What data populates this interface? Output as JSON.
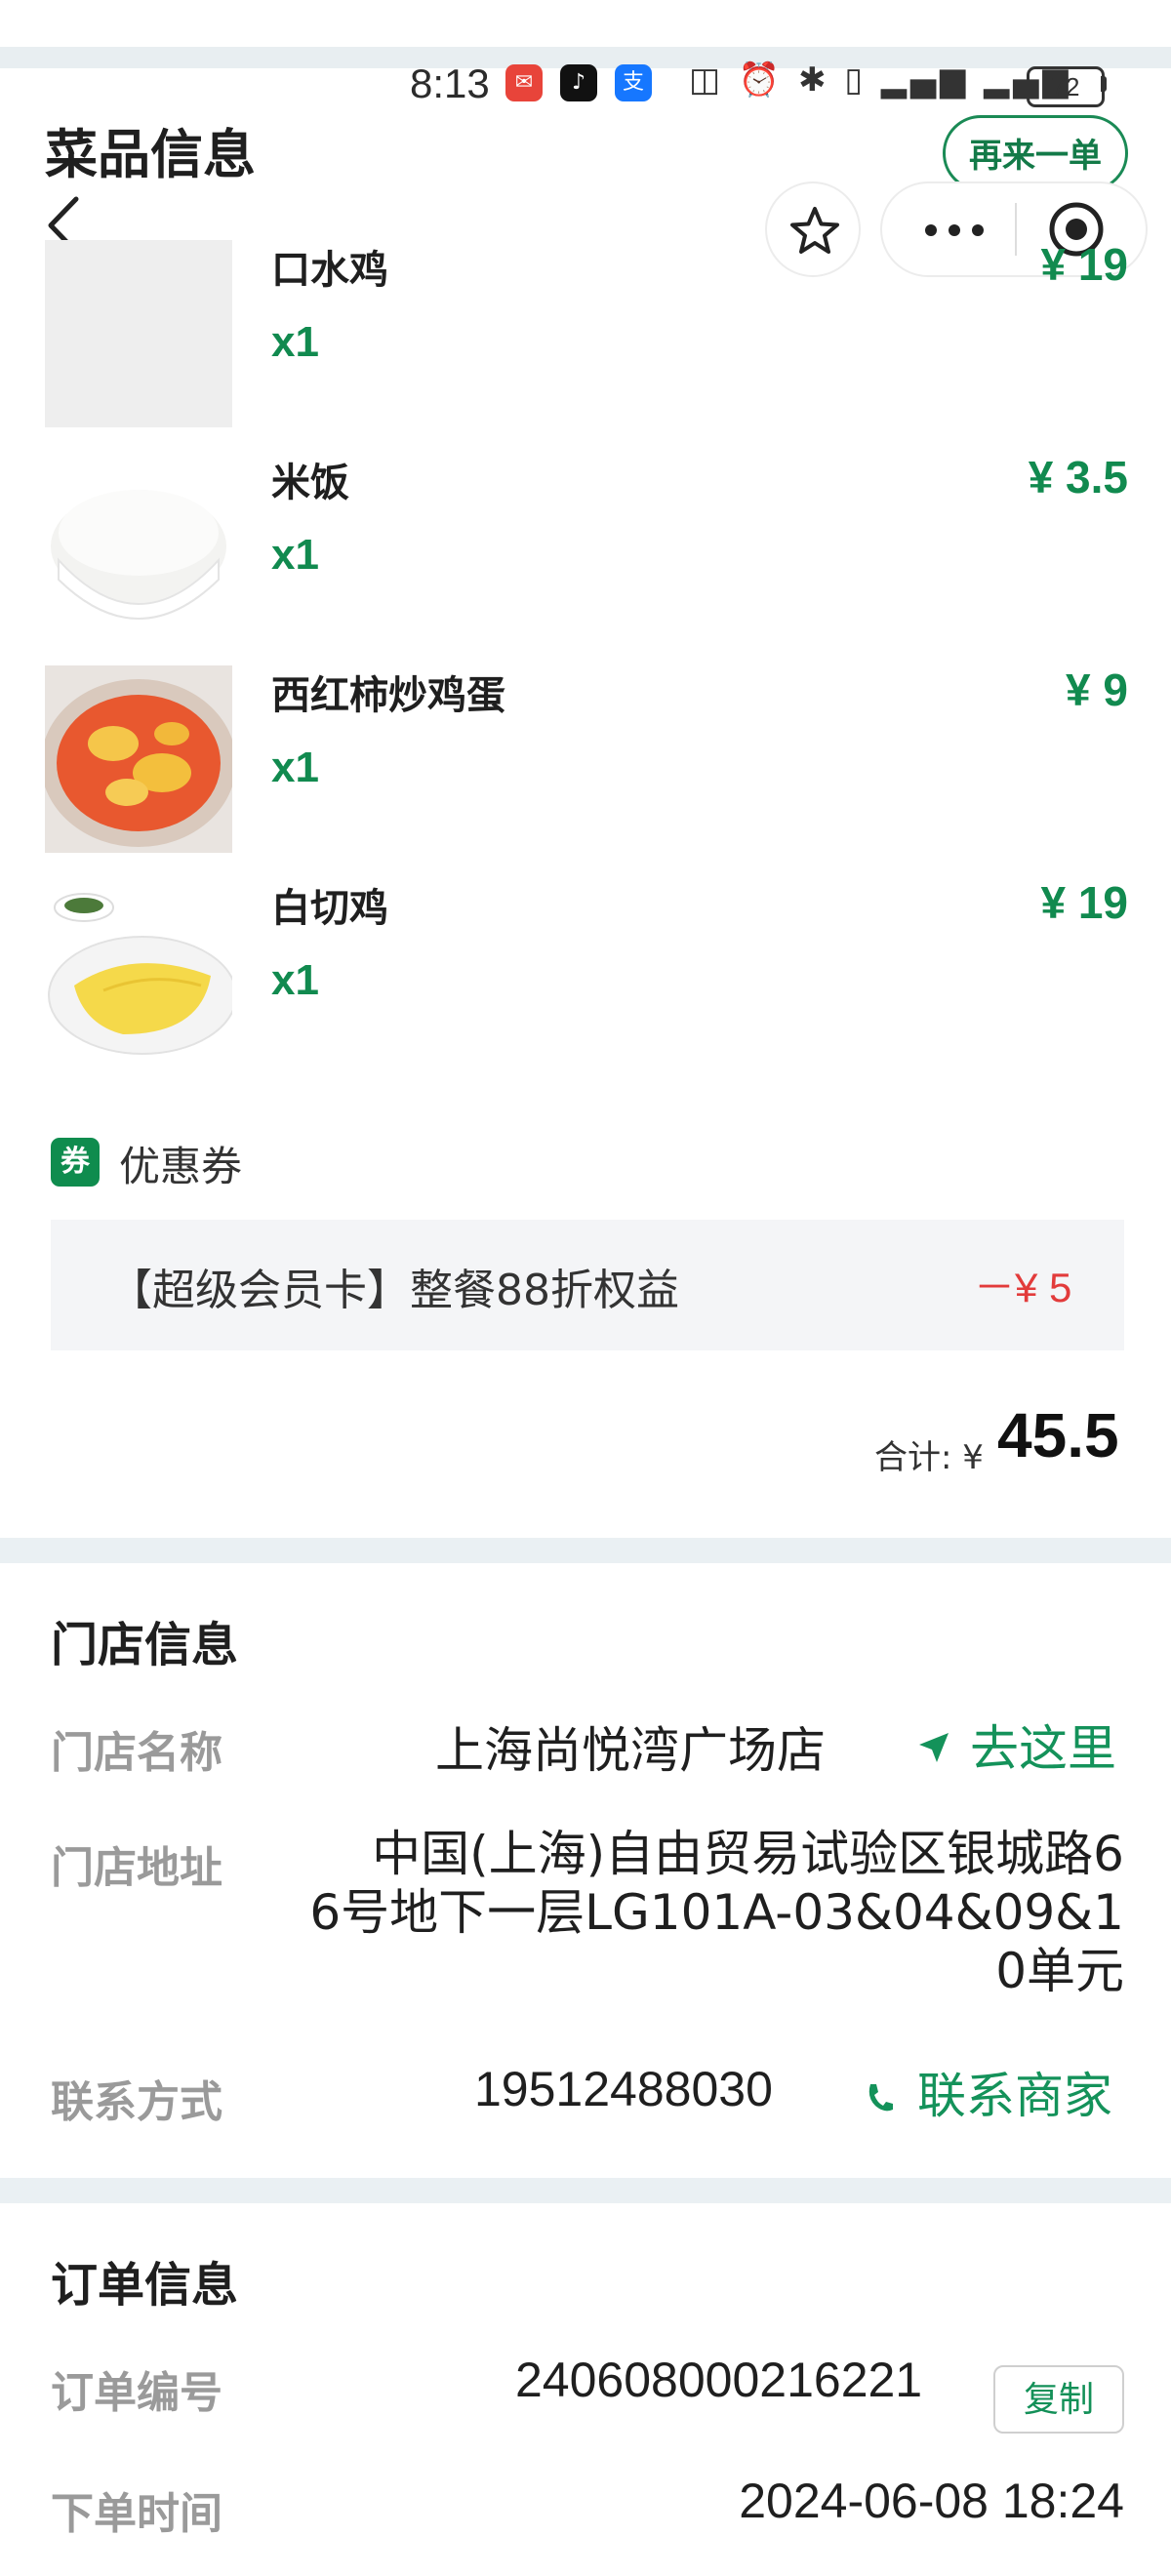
{
  "status_bar": {
    "time": "8:13",
    "battery": "72"
  },
  "header": {
    "title": "菜品信息",
    "reorder_label": "再来一单"
  },
  "dishes": [
    {
      "name": "口水鸡",
      "qty": "x1",
      "price": "¥ 19"
    },
    {
      "name": "米饭",
      "qty": "x1",
      "price": "¥ 3.5"
    },
    {
      "name": "西红柿炒鸡蛋",
      "qty": "x1",
      "price": "¥ 9"
    },
    {
      "name": "白切鸡",
      "qty": "x1",
      "price": "¥ 19"
    }
  ],
  "coupon": {
    "badge": "券",
    "label": "优惠券",
    "name": "【超级会员卡】整餐88折权益",
    "amount": "－¥ 5"
  },
  "total": {
    "label": "合计: ¥",
    "value": "45.5"
  },
  "store": {
    "title": "门店信息",
    "name_label": "门店名称",
    "name": "上海尚悦湾广场店",
    "navigate": "去这里",
    "address_label": "门店地址",
    "address_lines": [
      "中国(上海)自由贸易试验区银城路6",
      "6号地下一层LG101A-03&04&09&1",
      "0单元"
    ],
    "contact_label": "联系方式",
    "phone": "19512488030",
    "contact_action": "联系商家"
  },
  "order": {
    "title": "订单信息",
    "number_label": "订单编号",
    "number": "240608000216221",
    "copy_label": "复制",
    "time_label": "下单时间",
    "time": "2024-06-08 18:24"
  },
  "colors": {
    "accent": "#118a4f",
    "discount": "#e23b3b",
    "separator": "#eaf0f3"
  }
}
